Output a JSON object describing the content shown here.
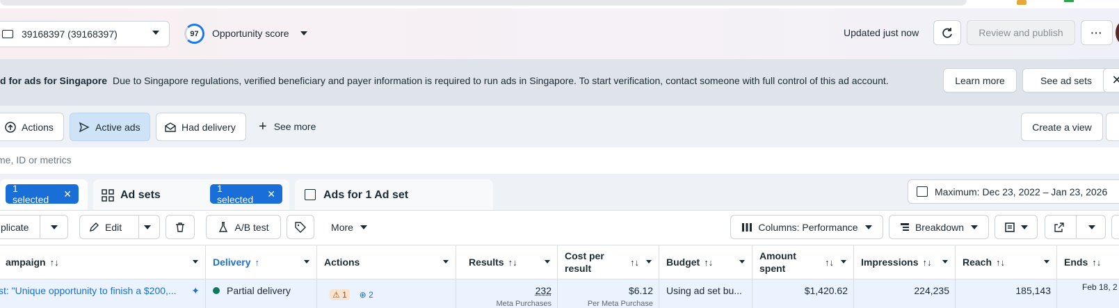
{
  "header": {
    "account": "39168397 (39168397)",
    "opportunity_score": "97",
    "opportunity_label": "Opportunity score",
    "updated_text": "Updated just now",
    "review_publish": "Review and publish",
    "more_label": "···"
  },
  "banner": {
    "title": "d for ads for Singapore",
    "text": "Due to Singapore regulations, verified beneficiary and payer information is required to run ads in Singapore. To start verification, contact someone with full control of this ad account.",
    "learn_more": "Learn more",
    "see_ad_sets": "See ad sets",
    "close": "✕"
  },
  "filters": {
    "actions": "Actions",
    "active_ads": "Active ads",
    "had_delivery": "Had delivery",
    "see_more": "See more",
    "create_view": "Create a view"
  },
  "search": {
    "placeholder": "me, ID or metrics"
  },
  "tabs": {
    "campaigns_selected": "1 selected",
    "ad_sets_label": "Ad sets",
    "ad_sets_selected": "1 selected",
    "ads_label": "Ads for 1 Ad set",
    "date_range": "Maximum: Dec 23, 2022 – Jan 23, 2026"
  },
  "toolbar": {
    "duplicate": "plicate",
    "edit": "Edit",
    "ab_test": "A/B test",
    "more": "More",
    "columns": "Columns: Performance",
    "breakdown": "Breakdown"
  },
  "table": {
    "columns": {
      "campaign": "ampaign",
      "delivery": "Delivery",
      "actions": "Actions",
      "results": "Results",
      "cost_per_result_1": "Cost per",
      "cost_per_result_2": "result",
      "budget": "Budget",
      "amount_spent_1": "Amount",
      "amount_spent_2": "spent",
      "impressions": "Impressions",
      "reach": "Reach",
      "ends": "Ends"
    },
    "row": {
      "campaign": "st: \"Unique opportunity to finish a $200,...",
      "delivery": "Partial delivery",
      "warnings": "1",
      "recommendations": "2",
      "results": "232",
      "results_sub": "Meta Purchases",
      "cost_per_result": "$6.12",
      "cost_sub": "Per Meta Purchase",
      "budget": "Using ad set bu...",
      "amount_spent": "$1,420.62",
      "impressions": "224,235",
      "reach": "185,143",
      "ends": "Feb 18, 2"
    }
  },
  "colors": {
    "accent": "#1a6ed8",
    "active_chip": "#cfe3f7",
    "banner_bg": "#dfe3ea",
    "delivery_dot": "#0f7a5a"
  }
}
